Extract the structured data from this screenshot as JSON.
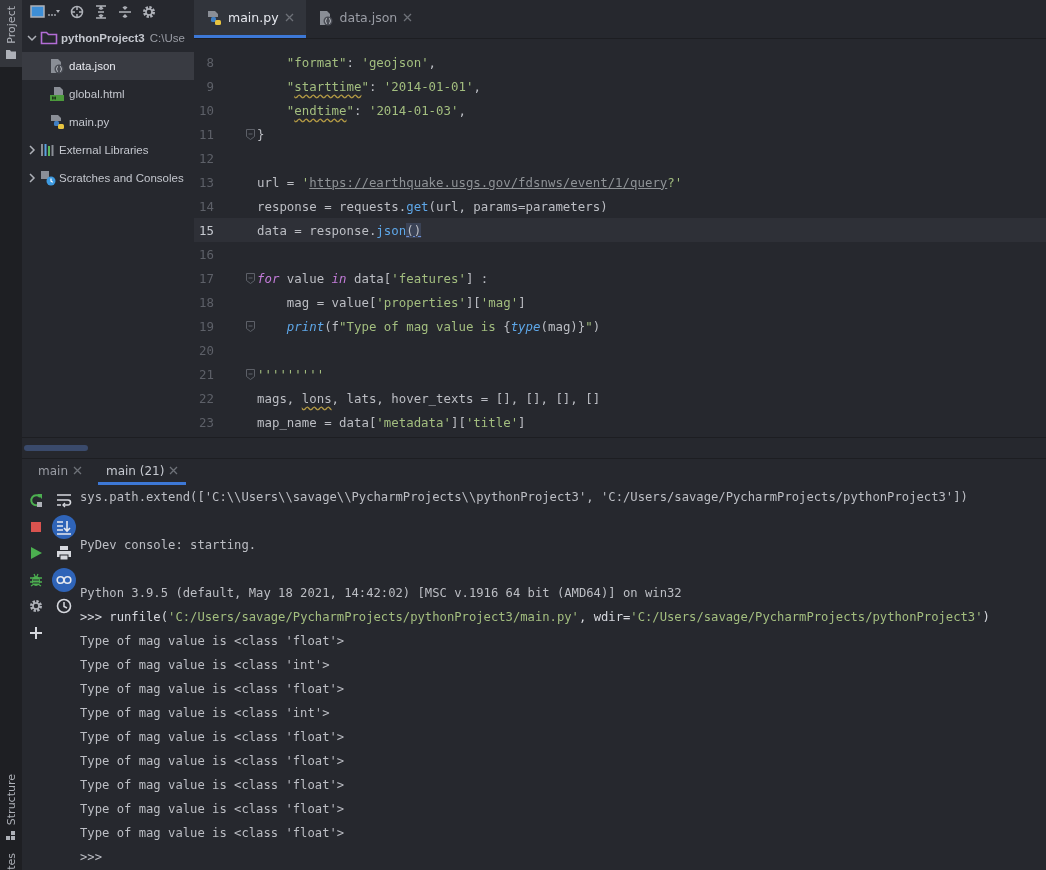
{
  "left_stripe": {
    "project_label": "Project",
    "structure_label": "Structure",
    "favorites_label": "tes"
  },
  "tree": [
    {
      "label": "pythonProject3",
      "path": "C:\\Use",
      "kind": "folder",
      "expanded": true,
      "selected": false,
      "children": [
        {
          "label": "data.json",
          "kind": "json",
          "selected": true
        },
        {
          "label": "global.html",
          "kind": "html",
          "selected": false
        },
        {
          "label": "main.py",
          "kind": "python",
          "selected": false
        }
      ]
    },
    {
      "label": "External Libraries",
      "kind": "libraries",
      "expanded": false,
      "selected": false
    },
    {
      "label": "Scratches and Consoles",
      "kind": "scratches",
      "expanded": false,
      "selected": false
    }
  ],
  "editor_tabs": [
    {
      "label": "main.py",
      "kind": "python",
      "selected": true
    },
    {
      "label": "data.json",
      "kind": "json",
      "selected": false
    }
  ],
  "code_lines": [
    {
      "number": "8",
      "current": false,
      "fold": false,
      "tokens": [
        {
          "kind": "str",
          "text": "    \"format\""
        },
        {
          "kind": "plain",
          "text": ": "
        },
        {
          "kind": "str",
          "text": "'geojson'"
        },
        {
          "kind": "plain",
          "text": ","
        }
      ]
    },
    {
      "number": "9",
      "current": false,
      "fold": false,
      "tokens": [
        {
          "kind": "str",
          "text": "    \""
        },
        {
          "kind": "typo",
          "text": "starttime"
        },
        {
          "kind": "str",
          "text": "\""
        },
        {
          "kind": "plain",
          "text": ": "
        },
        {
          "kind": "str",
          "text": "'2014-01-01'"
        },
        {
          "kind": "plain",
          "text": ","
        }
      ]
    },
    {
      "number": "10",
      "current": false,
      "fold": false,
      "tokens": [
        {
          "kind": "str",
          "text": "    \""
        },
        {
          "kind": "typo",
          "text": "endtime"
        },
        {
          "kind": "str",
          "text": "\""
        },
        {
          "kind": "plain",
          "text": ": "
        },
        {
          "kind": "str",
          "text": "'2014-01-03'"
        },
        {
          "kind": "plain",
          "text": ","
        }
      ]
    },
    {
      "number": "11",
      "current": false,
      "fold": true,
      "tokens": [
        {
          "kind": "plain",
          "text": "}"
        }
      ]
    },
    {
      "number": "12",
      "current": false,
      "fold": false
    },
    {
      "number": "13",
      "current": false,
      "fold": false,
      "tokens": [
        {
          "kind": "plain",
          "text": "url = "
        },
        {
          "kind": "str",
          "text": "'"
        },
        {
          "kind": "url",
          "text": "https://earthquake.usgs.gov/fdsnws/event/1/query"
        },
        {
          "kind": "str",
          "text": "?'"
        }
      ]
    },
    {
      "number": "14",
      "current": false,
      "fold": false,
      "tokens": [
        {
          "kind": "plain",
          "text": "response = requests."
        },
        {
          "kind": "call",
          "text": "get"
        },
        {
          "kind": "plain",
          "text": "(url, params=parameters)"
        }
      ]
    },
    {
      "number": "15",
      "current": true,
      "fold": false,
      "tokens": [
        {
          "kind": "plain",
          "text": "data = response."
        },
        {
          "kind": "call",
          "text": "json"
        },
        {
          "kind": "brace",
          "text": "()"
        }
      ]
    },
    {
      "number": "16",
      "current": false,
      "fold": false
    },
    {
      "number": "17",
      "current": false,
      "fold": true,
      "tokens": [
        {
          "kind": "kw",
          "text": "for"
        },
        {
          "kind": "plain",
          "text": " value "
        },
        {
          "kind": "kw",
          "text": "in"
        },
        {
          "kind": "plain",
          "text": " data["
        },
        {
          "kind": "str",
          "text": "'features'"
        },
        {
          "kind": "plain",
          "text": "] :"
        }
      ]
    },
    {
      "number": "18",
      "current": false,
      "fold": false,
      "tokens": [
        {
          "kind": "plain",
          "text": "    mag = value["
        },
        {
          "kind": "str",
          "text": "'properties'"
        },
        {
          "kind": "plain",
          "text": "]["
        },
        {
          "kind": "str",
          "text": "'mag'"
        },
        {
          "kind": "plain",
          "text": "]"
        }
      ]
    },
    {
      "number": "19",
      "current": false,
      "fold": true,
      "tokens": [
        {
          "kind": "builtin",
          "text": "    print"
        },
        {
          "kind": "plain",
          "text": "(f"
        },
        {
          "kind": "str",
          "text": "\"Type of mag value is "
        },
        {
          "kind": "plain",
          "text": "{"
        },
        {
          "kind": "builtin",
          "text": "type"
        },
        {
          "kind": "plain",
          "text": "(mag)}"
        },
        {
          "kind": "str",
          "text": "\""
        },
        {
          "kind": "plain",
          "text": ")"
        }
      ]
    },
    {
      "number": "20",
      "current": false,
      "fold": false
    },
    {
      "number": "21",
      "current": false,
      "fold": true,
      "tokens": [
        {
          "kind": "str",
          "text": "'''''''''"
        }
      ]
    },
    {
      "number": "22",
      "current": false,
      "fold": false,
      "tokens": [
        {
          "kind": "plain",
          "text": "mags, "
        },
        {
          "kind": "typo-plain",
          "text": "lons"
        },
        {
          "kind": "plain",
          "text": ", lats, hover_texts = [], [], [], []"
        }
      ]
    },
    {
      "number": "23",
      "current": false,
      "fold": false,
      "tokens": [
        {
          "kind": "plain",
          "text": "map_name = data["
        },
        {
          "kind": "str",
          "text": "'metadata'"
        },
        {
          "kind": "plain",
          "text": "]["
        },
        {
          "kind": "str",
          "text": "'title'"
        },
        {
          "kind": "plain",
          "text": "]"
        }
      ]
    }
  ],
  "console_tabs": [
    {
      "label": "main",
      "selected": false
    },
    {
      "label": "main (21)",
      "selected": true
    }
  ],
  "console_actions": [
    {
      "kind": "rerun"
    },
    {
      "kind": "stop"
    },
    {
      "kind": "run"
    },
    {
      "kind": "debug"
    },
    {
      "kind": "settings"
    },
    {
      "kind": "add"
    }
  ],
  "console_toggles": [
    {
      "kind": "wrap",
      "on": false
    },
    {
      "kind": "scroll-end",
      "on": true
    },
    {
      "kind": "print",
      "on": false
    },
    {
      "kind": "variables",
      "on": true
    },
    {
      "kind": "history",
      "on": false
    }
  ],
  "console_lines": [
    {
      "kind": "text",
      "tokens": [
        {
          "kind": "out",
          "text": "sys.path.extend(['C:\\\\Users\\\\savage\\\\PycharmProjects\\\\pythonProject3', 'C:/Users/savage/PycharmProjects/pythonProject3'])"
        }
      ]
    },
    {
      "kind": "blank"
    },
    {
      "kind": "text",
      "tokens": [
        {
          "kind": "out",
          "text": "PyDev console: starting."
        }
      ]
    },
    {
      "kind": "blank"
    },
    {
      "kind": "text",
      "tokens": [
        {
          "kind": "out",
          "text": "Python 3.9.5 (default, May 18 2021, 14:42:02) [MSC v.1916 64 bit (AMD64)] on win32"
        }
      ]
    },
    {
      "kind": "text",
      "tokens": [
        {
          "kind": "prompt",
          "text": ">>> runfile("
        },
        {
          "kind": "str",
          "text": "'C:/Users/savage/PycharmProjects/pythonProject3/main.py'"
        },
        {
          "kind": "prompt",
          "text": ", wdir="
        },
        {
          "kind": "str",
          "text": "'C:/Users/savage/PycharmProjects/pythonProject3'"
        },
        {
          "kind": "prompt",
          "text": ")"
        }
      ]
    },
    {
      "kind": "text",
      "tokens": [
        {
          "kind": "out",
          "text": "Type of mag value is <class 'float'>"
        }
      ]
    },
    {
      "kind": "text",
      "tokens": [
        {
          "kind": "out",
          "text": "Type of mag value is <class 'int'>"
        }
      ]
    },
    {
      "kind": "text",
      "tokens": [
        {
          "kind": "out",
          "text": "Type of mag value is <class 'float'>"
        }
      ]
    },
    {
      "kind": "text",
      "tokens": [
        {
          "kind": "out",
          "text": "Type of mag value is <class 'int'>"
        }
      ]
    },
    {
      "kind": "text",
      "tokens": [
        {
          "kind": "out",
          "text": "Type of mag value is <class 'float'>"
        }
      ]
    },
    {
      "kind": "text",
      "tokens": [
        {
          "kind": "out",
          "text": "Type of mag value is <class 'float'>"
        }
      ]
    },
    {
      "kind": "text",
      "tokens": [
        {
          "kind": "out",
          "text": "Type of mag value is <class 'float'>"
        }
      ]
    },
    {
      "kind": "text",
      "tokens": [
        {
          "kind": "out",
          "text": "Type of mag value is <class 'float'>"
        }
      ]
    },
    {
      "kind": "text",
      "tokens": [
        {
          "kind": "out",
          "text": "Type of mag value is <class 'float'>"
        }
      ]
    },
    {
      "kind": "text",
      "tokens": [
        {
          "kind": "out",
          "text": ">>>"
        }
      ]
    }
  ]
}
